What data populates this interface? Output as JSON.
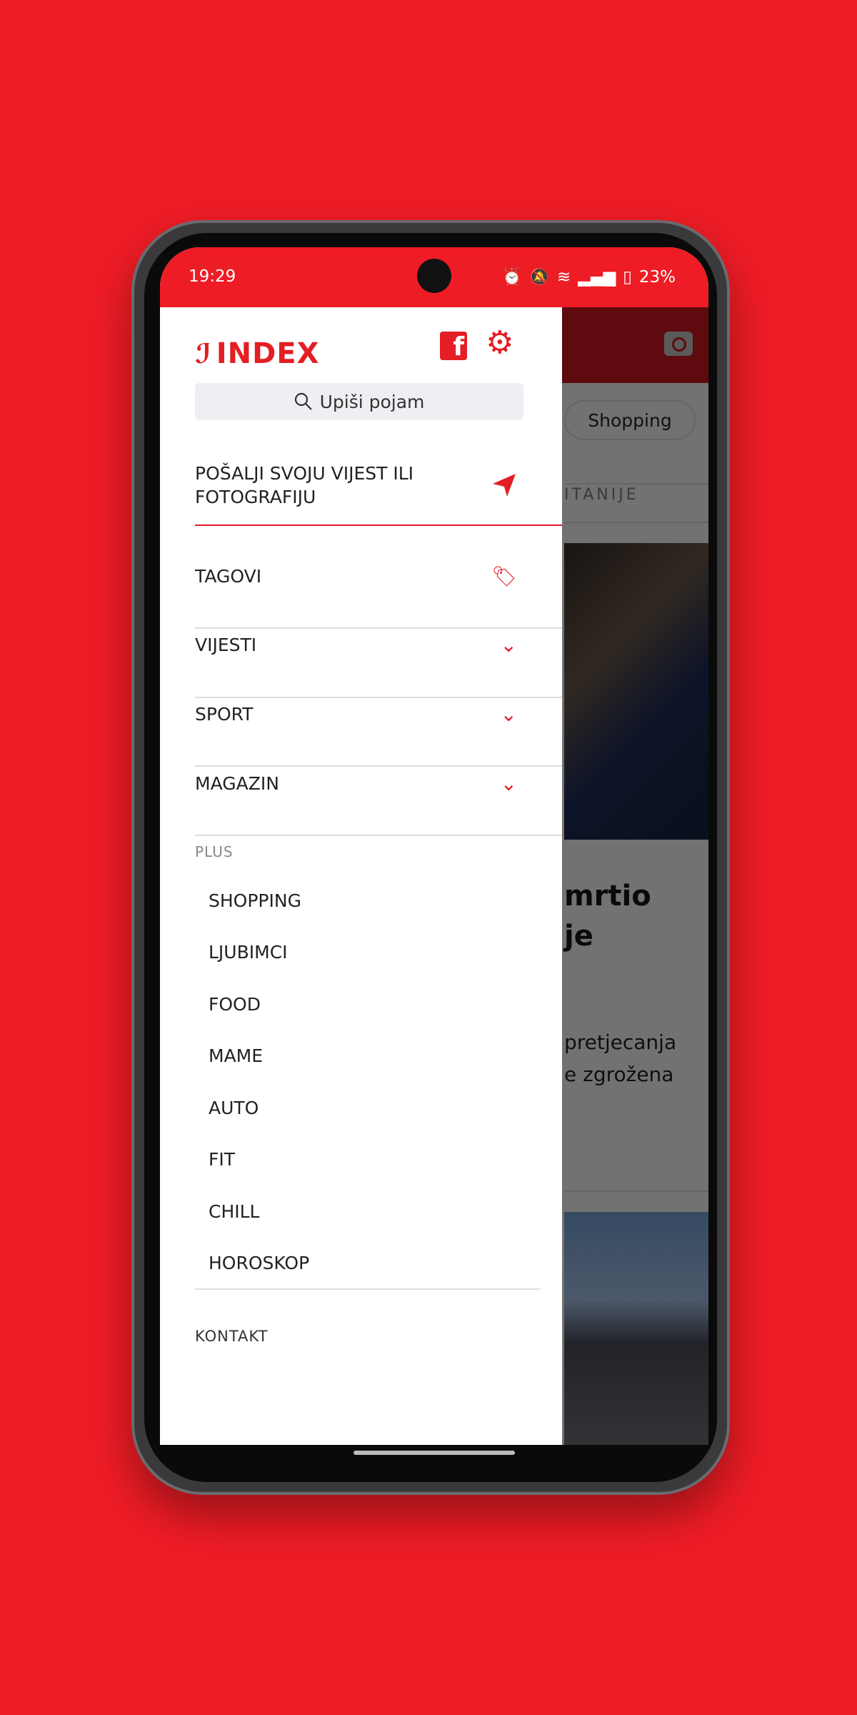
{
  "status": {
    "time": "19:29",
    "battery": "23%",
    "icons": [
      "alarm-icon",
      "mute-icon",
      "wifi-icon",
      "signal-icon",
      "battery-icon"
    ]
  },
  "drawer": {
    "logo": "INDEX",
    "search_placeholder": "Upiši pojam",
    "submit_line1": "POŠALJI SVOJU VIJEST ILI",
    "submit_line2": "FOTOGRAFIJU",
    "items": [
      {
        "label": "TAGOVI",
        "icon": "tag-icon"
      },
      {
        "label": "VIJESTI",
        "icon": "chevron-down-icon"
      },
      {
        "label": "SPORT",
        "icon": "chevron-down-icon"
      },
      {
        "label": "MAGAZIN",
        "icon": "chevron-down-icon"
      }
    ],
    "plus_heading": "PLUS",
    "plus_items": [
      "SHOPPING",
      "LJUBIMCI",
      "FOOD",
      "MAME",
      "AUTO",
      "FIT",
      "CHILL",
      "HOROSKOP"
    ],
    "contact": "KONTAKT"
  },
  "background": {
    "chip": "Shopping",
    "tab": "ITANIJE",
    "headline_1": "mrtio",
    "headline_2": "je",
    "lead_1": "pretjecanja",
    "lead_2": "e zgrožena"
  },
  "colors": {
    "brand": "#e31e24",
    "background": "#ee1c25"
  }
}
